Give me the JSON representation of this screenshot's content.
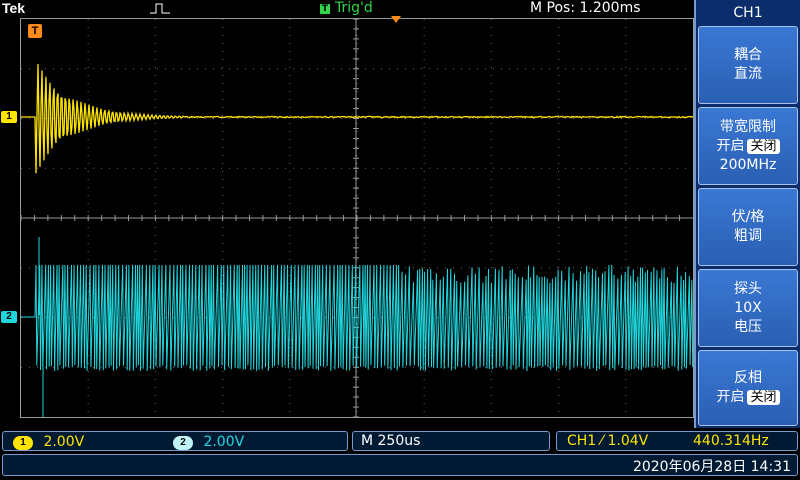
{
  "top": {
    "brand": "Tek",
    "trigger_status": "Trig'd",
    "trigger_icon_letter": "T",
    "horizontal_position": "M Pos: 1.200ms"
  },
  "markers": {
    "ch1": "1",
    "ch2": "2",
    "trigger_point": "T"
  },
  "side_menu": {
    "title": "CH1",
    "buttons": [
      {
        "line1": "耦合",
        "line2": "直流"
      },
      {
        "line1": "带宽限制",
        "line2_left": "开启",
        "line2_selected": "关闭",
        "line3": "200MHz"
      },
      {
        "line1": "伏/格",
        "line2": "粗调"
      },
      {
        "line1": "探头",
        "line2": "10X",
        "line3": "电压"
      },
      {
        "line1": "反相",
        "line2_left": "开启",
        "line2_selected": "关闭"
      }
    ]
  },
  "status": {
    "ch1_label": "1",
    "ch1_scale": "2.00V",
    "ch2_label": "2",
    "ch2_scale": "2.00V",
    "timebase": "M 250us",
    "trigger_source": "CH1",
    "trigger_slope": "⁄",
    "trigger_level": "1.04V",
    "frequency": "440.314Hz",
    "datetime": "2020年06月28日 14:31"
  },
  "colors": {
    "ch1": "#ffe400",
    "ch2": "#20d6dd",
    "trigger": "#2fd64a",
    "marker": "#ff8a1a",
    "menu_bg": "#0b2d6b"
  }
}
